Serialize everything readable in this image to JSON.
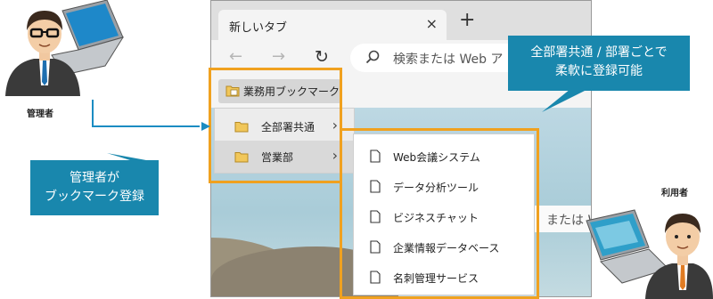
{
  "browser": {
    "tab": {
      "title": "新しいタブ",
      "close": "×"
    },
    "new_tab": "+",
    "nav": {
      "back": "←",
      "forward": "→",
      "refresh": "↻"
    },
    "address_placeholder": "検索または Web ア",
    "favorites_folder": "業務用ブックマーク",
    "page_search_placeholder": "または Web"
  },
  "menu_level1": [
    {
      "label": "全部署共通",
      "chevron": "›"
    },
    {
      "label": "営業部",
      "chevron": "›"
    }
  ],
  "menu_level2": [
    {
      "label": "Web会議システム"
    },
    {
      "label": "データ分析ツール"
    },
    {
      "label": "ビジネスチャット"
    },
    {
      "label": "企業情報データベース"
    },
    {
      "label": "名刺管理サービス"
    }
  ],
  "admin": {
    "caption": "管理者"
  },
  "user": {
    "caption": "利用者"
  },
  "callouts": {
    "left": [
      "管理者が",
      "ブックマーク登録"
    ],
    "right": [
      "全部署共通 / 部署ごとで",
      "柔軟に登録可能"
    ]
  },
  "colors": {
    "accent_orange": "#f0a11f",
    "callout_blue": "#1987ad",
    "connector_blue": "#1b8cc2"
  }
}
